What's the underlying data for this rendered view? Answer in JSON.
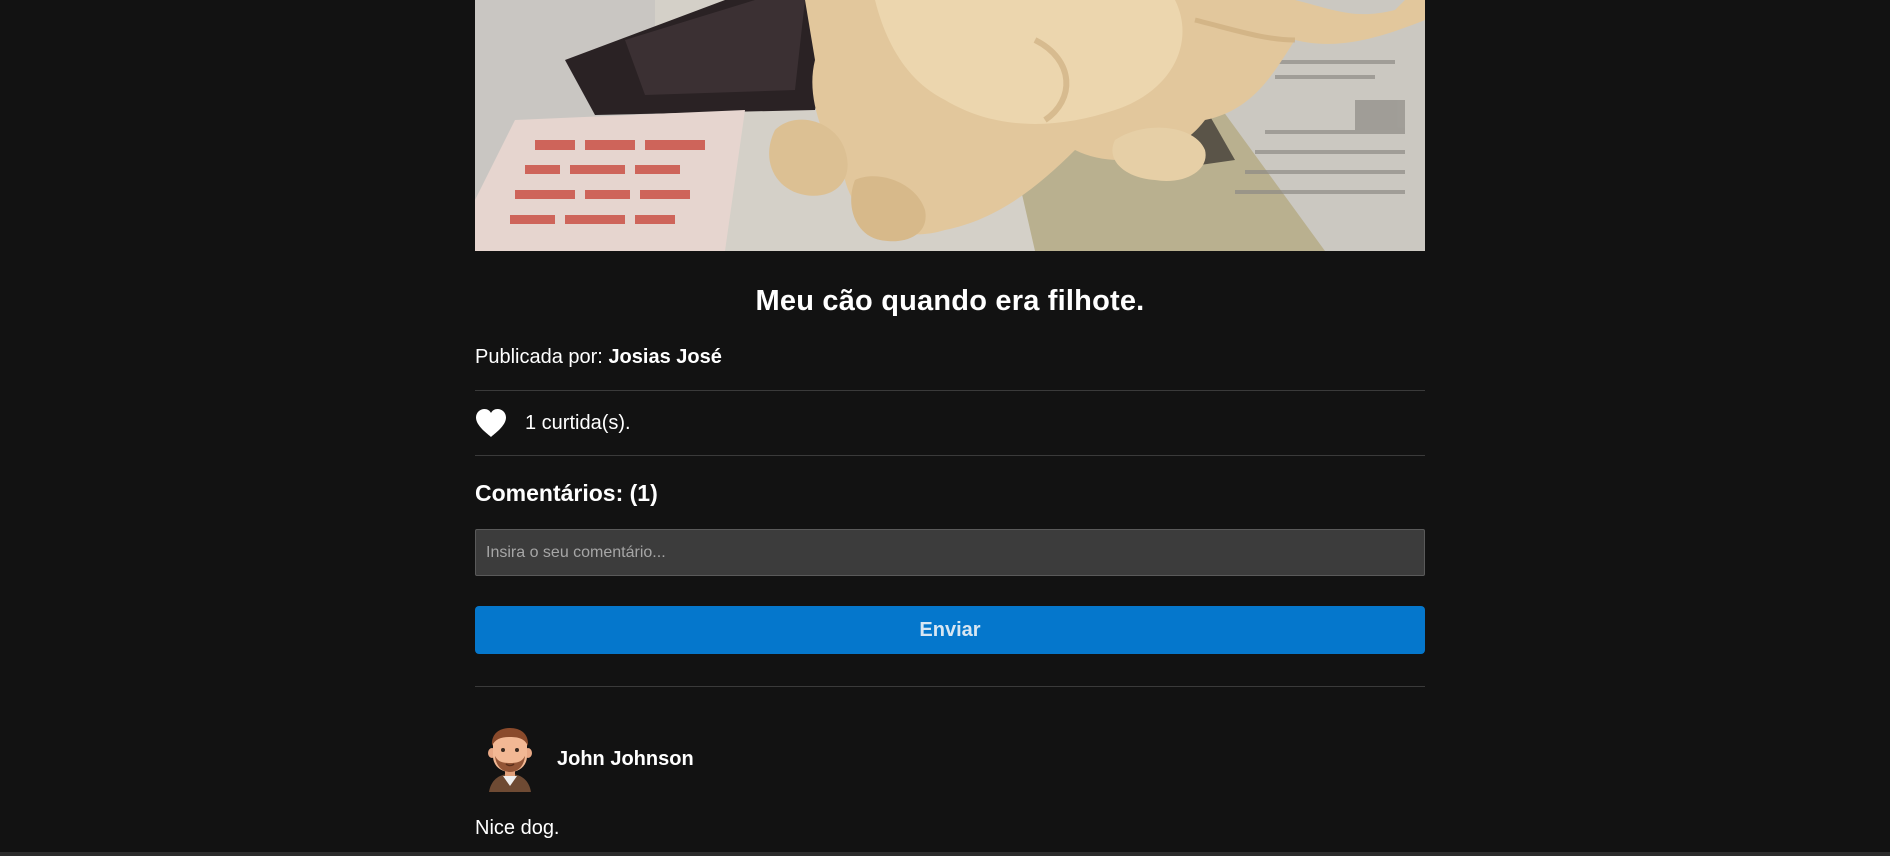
{
  "post": {
    "title": "Meu cão quando era filhote.",
    "published_by_label": "Publicada por:",
    "author": "Josias José",
    "likes_text": "1 curtida(s).",
    "comments_title": "Comentários: (1)"
  },
  "comment_form": {
    "placeholder": "Insira o seu comentário...",
    "submit_label": "Enviar"
  },
  "comments": [
    {
      "author": "John Johnson",
      "text": "Nice dog."
    }
  ],
  "colors": {
    "background": "#121212",
    "button": "#0577cc",
    "input": "#3c3c3c"
  },
  "icons": {
    "like": "heart-icon",
    "avatar": "man-avatar-icon"
  }
}
